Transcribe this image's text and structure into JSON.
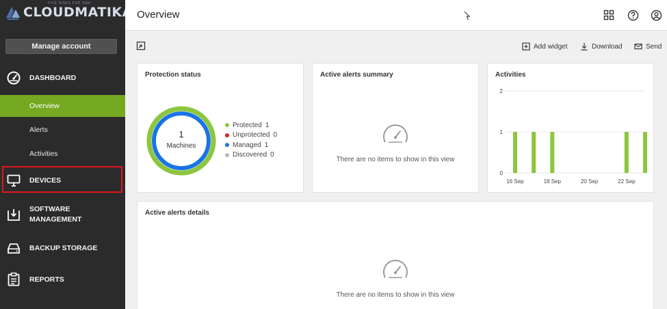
{
  "brand": {
    "logo_text": "CLOUDMATIKA",
    "logo_tagline": "FIVE NINES FOR SMB",
    "accent": "#76a922",
    "highlight": "#e0161d"
  },
  "sidebar": {
    "manage_account": "Manage account",
    "sections": [
      {
        "label": "DASHBOARD",
        "icon": "dashboard-gauge-icon"
      },
      {
        "label": "DEVICES",
        "icon": "monitor-icon"
      },
      {
        "label": "SOFTWARE\nMANAGEMENT",
        "icon": "software-download-icon"
      },
      {
        "label": "BACKUP STORAGE",
        "icon": "storage-drive-icon"
      },
      {
        "label": "REPORTS",
        "icon": "reports-clipboard-icon"
      }
    ],
    "dashboard_items": [
      {
        "label": "Overview",
        "active": true
      },
      {
        "label": "Alerts",
        "active": false
      },
      {
        "label": "Activities",
        "active": false
      }
    ]
  },
  "header": {
    "title": "Overview",
    "icons": [
      "grid-icon",
      "help-icon",
      "user-icon"
    ]
  },
  "toolbar": {
    "add_widget": "Add widget",
    "download": "Download",
    "send": "Send"
  },
  "widgets": {
    "protection": {
      "title": "Protection status",
      "center_value": "1",
      "center_label": "Machines",
      "legend": [
        {
          "label": "Protected",
          "value": "1",
          "color": "#8cc63f"
        },
        {
          "label": "Unprotected",
          "value": "0",
          "color": "#e02020"
        },
        {
          "label": "Managed",
          "value": "1",
          "color": "#1a73e8"
        },
        {
          "label": "Discovered",
          "value": "0",
          "color": "#b8b8b8"
        }
      ]
    },
    "alerts_summary": {
      "title": "Active alerts summary",
      "empty_text": "There are no items to show in this view"
    },
    "activities": {
      "title": "Activities",
      "bar_color": "#8cc63f"
    },
    "alerts_details": {
      "title": "Active alerts details",
      "empty_text": "There are no items to show in this view"
    }
  },
  "chart_data": {
    "type": "bar",
    "title": "Activities",
    "categories": [
      "16 Sep",
      "17 Sep",
      "18 Sep",
      "19 Sep",
      "20 Sep",
      "21 Sep",
      "22 Sep",
      "23 Sep"
    ],
    "values": [
      1,
      1,
      1,
      0,
      0,
      0,
      1,
      1
    ],
    "x_tick_labels": [
      "16 Sep",
      "18 Sep",
      "20 Sep",
      "22 Sep"
    ],
    "y_ticks": [
      "0",
      "1",
      "2"
    ],
    "ylim": [
      0,
      2
    ],
    "grid": true,
    "xlabel": "",
    "ylabel": ""
  }
}
